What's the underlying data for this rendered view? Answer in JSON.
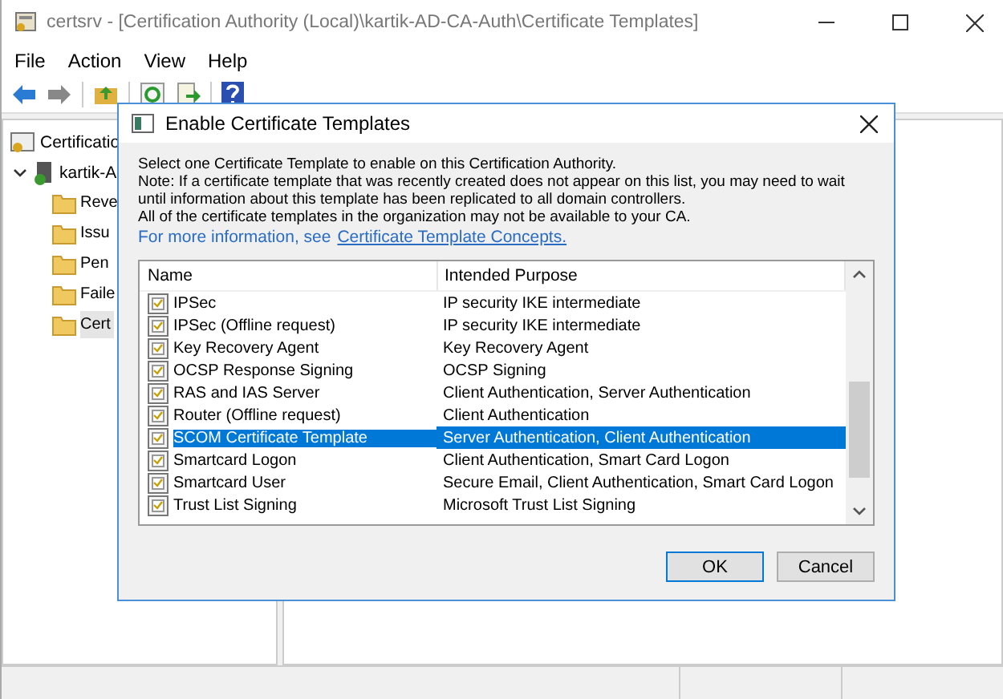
{
  "window": {
    "title": "certsrv - [Certification Authority (Local)\\kartik-AD-CA-Auth\\Certificate Templates]"
  },
  "menu": [
    "File",
    "Action",
    "View",
    "Help"
  ],
  "tree": {
    "label": "Certificatio",
    "children": [
      {
        "label": "kartik-A",
        "expanded": true,
        "children": [
          {
            "label": "Reve",
            "selected": false
          },
          {
            "label": "Issu",
            "selected": false
          },
          {
            "label": "Pen",
            "selected": false
          },
          {
            "label": "Faile",
            "selected": false
          },
          {
            "label": "Cert",
            "selected": true
          }
        ]
      }
    ]
  },
  "dialog": {
    "title": "Enable Certificate Templates",
    "intro": [
      "Select one Certificate Template to enable on this Certification Authority.",
      "Note: If a certificate template that was recently created does not appear on this list, you may need to wait until information about this template has been replicated to all domain controllers.",
      "All of the certificate templates in the organization may not be available to your CA."
    ],
    "more_info": "For more information, see",
    "link": "Certificate Template Concepts.",
    "table": {
      "columns": [
        "Name",
        "Intended Purpose"
      ],
      "rows": [
        {
          "name": "IPSec",
          "purpose": "IP security IKE intermediate",
          "selected": false
        },
        {
          "name": "IPSec (Offline request)",
          "purpose": "IP security IKE intermediate",
          "selected": false
        },
        {
          "name": "Key Recovery Agent",
          "purpose": "Key Recovery Agent",
          "selected": false
        },
        {
          "name": "OCSP Response Signing",
          "purpose": "OCSP Signing",
          "selected": false
        },
        {
          "name": "RAS and IAS Server",
          "purpose": "Client Authentication, Server Authentication",
          "selected": false
        },
        {
          "name": "Router (Offline request)",
          "purpose": "Client Authentication",
          "selected": false
        },
        {
          "name": "SCOM Certificate Template",
          "purpose": "Server Authentication, Client Authentication",
          "selected": true
        },
        {
          "name": "Smartcard Logon",
          "purpose": "Client Authentication, Smart Card Logon",
          "selected": false
        },
        {
          "name": "Smartcard User",
          "purpose": "Secure Email, Client Authentication, Smart Card Logon",
          "selected": false
        },
        {
          "name": "Trust List Signing",
          "purpose": "Microsoft Trust List Signing",
          "selected": false
        }
      ]
    },
    "buttons": [
      {
        "label": "OK",
        "default": true
      },
      {
        "label": "Cancel",
        "default": false
      }
    ]
  }
}
